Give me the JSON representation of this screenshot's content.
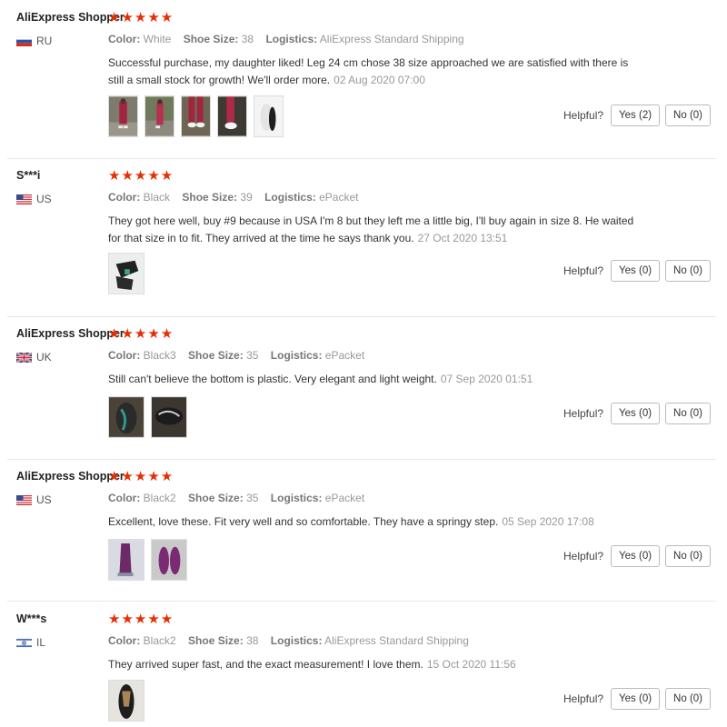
{
  "colors": {
    "star": "#e62e04",
    "label": "#777777",
    "date": "#999999"
  },
  "labels": {
    "color": "Color:",
    "shoe_size": "Shoe Size:",
    "logistics": "Logistics:",
    "helpful": "Helpful?"
  },
  "reviews": [
    {
      "user": "AliExpress Shopper",
      "country": "RU",
      "flag": "ru-flag-icon",
      "rating": 5,
      "stars": "★★★★★",
      "color": "White",
      "shoe_size": "38",
      "logistics": "AliExpress Standard Shipping",
      "text": "Successful purchase, my daughter liked! Leg 24 cm chose 38 size approached we are satisfied with there is still a small stock for growth! We'll order more.",
      "date": "02 Aug 2020 07:00",
      "photo_count": 5,
      "yes": "Yes (2)",
      "no": "No (0)"
    },
    {
      "user": "S***i",
      "country": "US",
      "flag": "us-flag-icon",
      "rating": 5,
      "stars": "★★★★★",
      "color": "Black",
      "shoe_size": "39",
      "logistics": "ePacket",
      "text": "They got here well, buy #9 because in USA I'm 8 but they left me a little big, I'll buy again in size 8. He waited for that size in to fit. They arrived at the time he says thank you.",
      "date": "27 Oct 2020 13:51",
      "photo_count": 1,
      "yes": "Yes (0)",
      "no": "No (0)"
    },
    {
      "user": "AliExpress Shopper",
      "country": "UK",
      "flag": "uk-flag-icon",
      "rating": 5,
      "stars": "★★★★★",
      "color": "Black3",
      "shoe_size": "35",
      "logistics": "ePacket",
      "text": "Still can't believe the bottom is plastic. Very elegant and light weight.",
      "date": "07 Sep 2020 01:51",
      "photo_count": 2,
      "yes": "Yes (0)",
      "no": "No (0)"
    },
    {
      "user": "AliExpress Shopper",
      "country": "US",
      "flag": "us-flag-icon",
      "rating": 5,
      "stars": "★★★★★",
      "color": "Black2",
      "shoe_size": "35",
      "logistics": "ePacket",
      "text": "Excellent, love these. Fit very well and so comfortable. They have a springy step.",
      "date": "05 Sep 2020 17:08",
      "photo_count": 2,
      "yes": "Yes (0)",
      "no": "No (0)"
    },
    {
      "user": "W***s",
      "country": "IL",
      "flag": "il-flag-icon",
      "rating": 5,
      "stars": "★★★★★",
      "color": "Black2",
      "shoe_size": "38",
      "logistics": "AliExpress Standard Shipping",
      "text": "They arrived super fast, and the exact measurement! I love them.",
      "date": "15 Oct 2020 11:56",
      "photo_count": 1,
      "yes": "Yes (0)",
      "no": "No (0)"
    }
  ]
}
